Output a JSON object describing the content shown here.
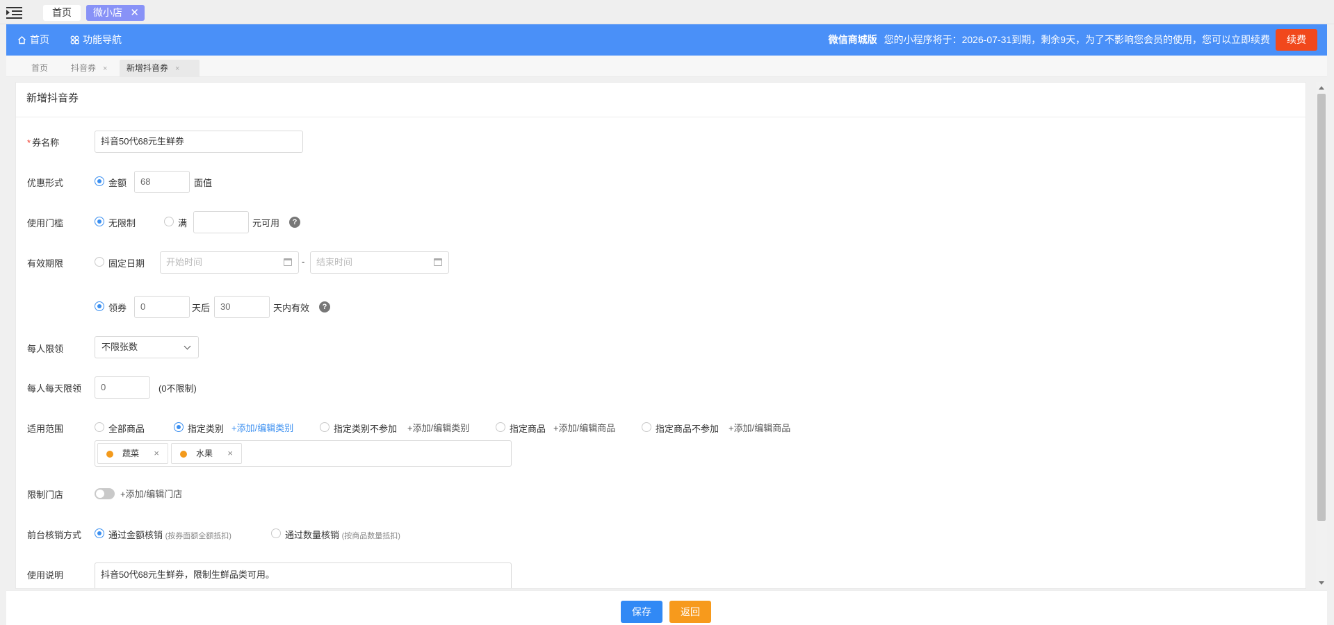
{
  "top_tabs": {
    "home": "首页",
    "shop": "微小店",
    "close": "✕"
  },
  "header": {
    "home": "首页",
    "func_nav": "功能导航",
    "edition": "微信商城版",
    "notice": "您的小程序将于：2026-07-31到期，剩余9天，为了不影响您会员的使用，您可以立即续费",
    "renew": "续费",
    "accent": "#4a90f8"
  },
  "breadcrumbs": [
    {
      "label": "首页",
      "close": ""
    },
    {
      "label": "抖音券",
      "close": "×"
    },
    {
      "label": "新增抖音券",
      "close": "×"
    }
  ],
  "form": {
    "title": "新增抖音券",
    "name": {
      "required": "*",
      "label": "券名称",
      "value": "抖音50代68元生鲜券"
    },
    "discount": {
      "label": "优惠形式",
      "option": "金额",
      "value": "68",
      "unit": "面值"
    },
    "threshold": {
      "label": "使用门槛",
      "opt_none": "无限制",
      "opt_full": "满",
      "value": "",
      "suffix": "元可用",
      "help": "?"
    },
    "validity": {
      "label": "有效期限",
      "opt_fixed": "固定日期",
      "start_placeholder": "开始时间",
      "dash": "-",
      "end_placeholder": "结束时间",
      "opt_receive": "领券",
      "after_value": "0",
      "after_label": "天后",
      "days_value": "30",
      "days_label": "天内有效",
      "help": "?"
    },
    "per_person": {
      "label": "每人限领",
      "value": "不限张数"
    },
    "per_day": {
      "label": "每人每天限领",
      "value": "0",
      "hint": "(0不限制)"
    },
    "scope": {
      "label": "适用范围",
      "opt_all": "全部商品",
      "opt_category": "指定类别",
      "link_category": "+添加/编辑类别",
      "opt_category_ex": "指定类别不参加",
      "link_category_ex": "+添加/编辑类别",
      "opt_goods": "指定商品",
      "link_goods": "+添加/编辑商品",
      "opt_goods_ex": "指定商品不参加",
      "link_goods_ex": "+添加/编辑商品",
      "tags": [
        {
          "label": "蔬菜",
          "close": "×"
        },
        {
          "label": "水果",
          "close": "×"
        }
      ]
    },
    "store": {
      "label": "限制门店",
      "link": "+添加/编辑门店"
    },
    "verify": {
      "label": "前台核销方式",
      "opt_amount": "通过金额核销",
      "opt_amount_note": "(按券面额全额抵扣)",
      "opt_qty": "通过数量核销",
      "opt_qty_note": "(按商品数量抵扣)"
    },
    "desc": {
      "label": "使用说明",
      "value": "抖音50代68元生鲜券，限制生鲜品类可用。"
    }
  },
  "footer": {
    "save": "保存",
    "back": "返回"
  }
}
